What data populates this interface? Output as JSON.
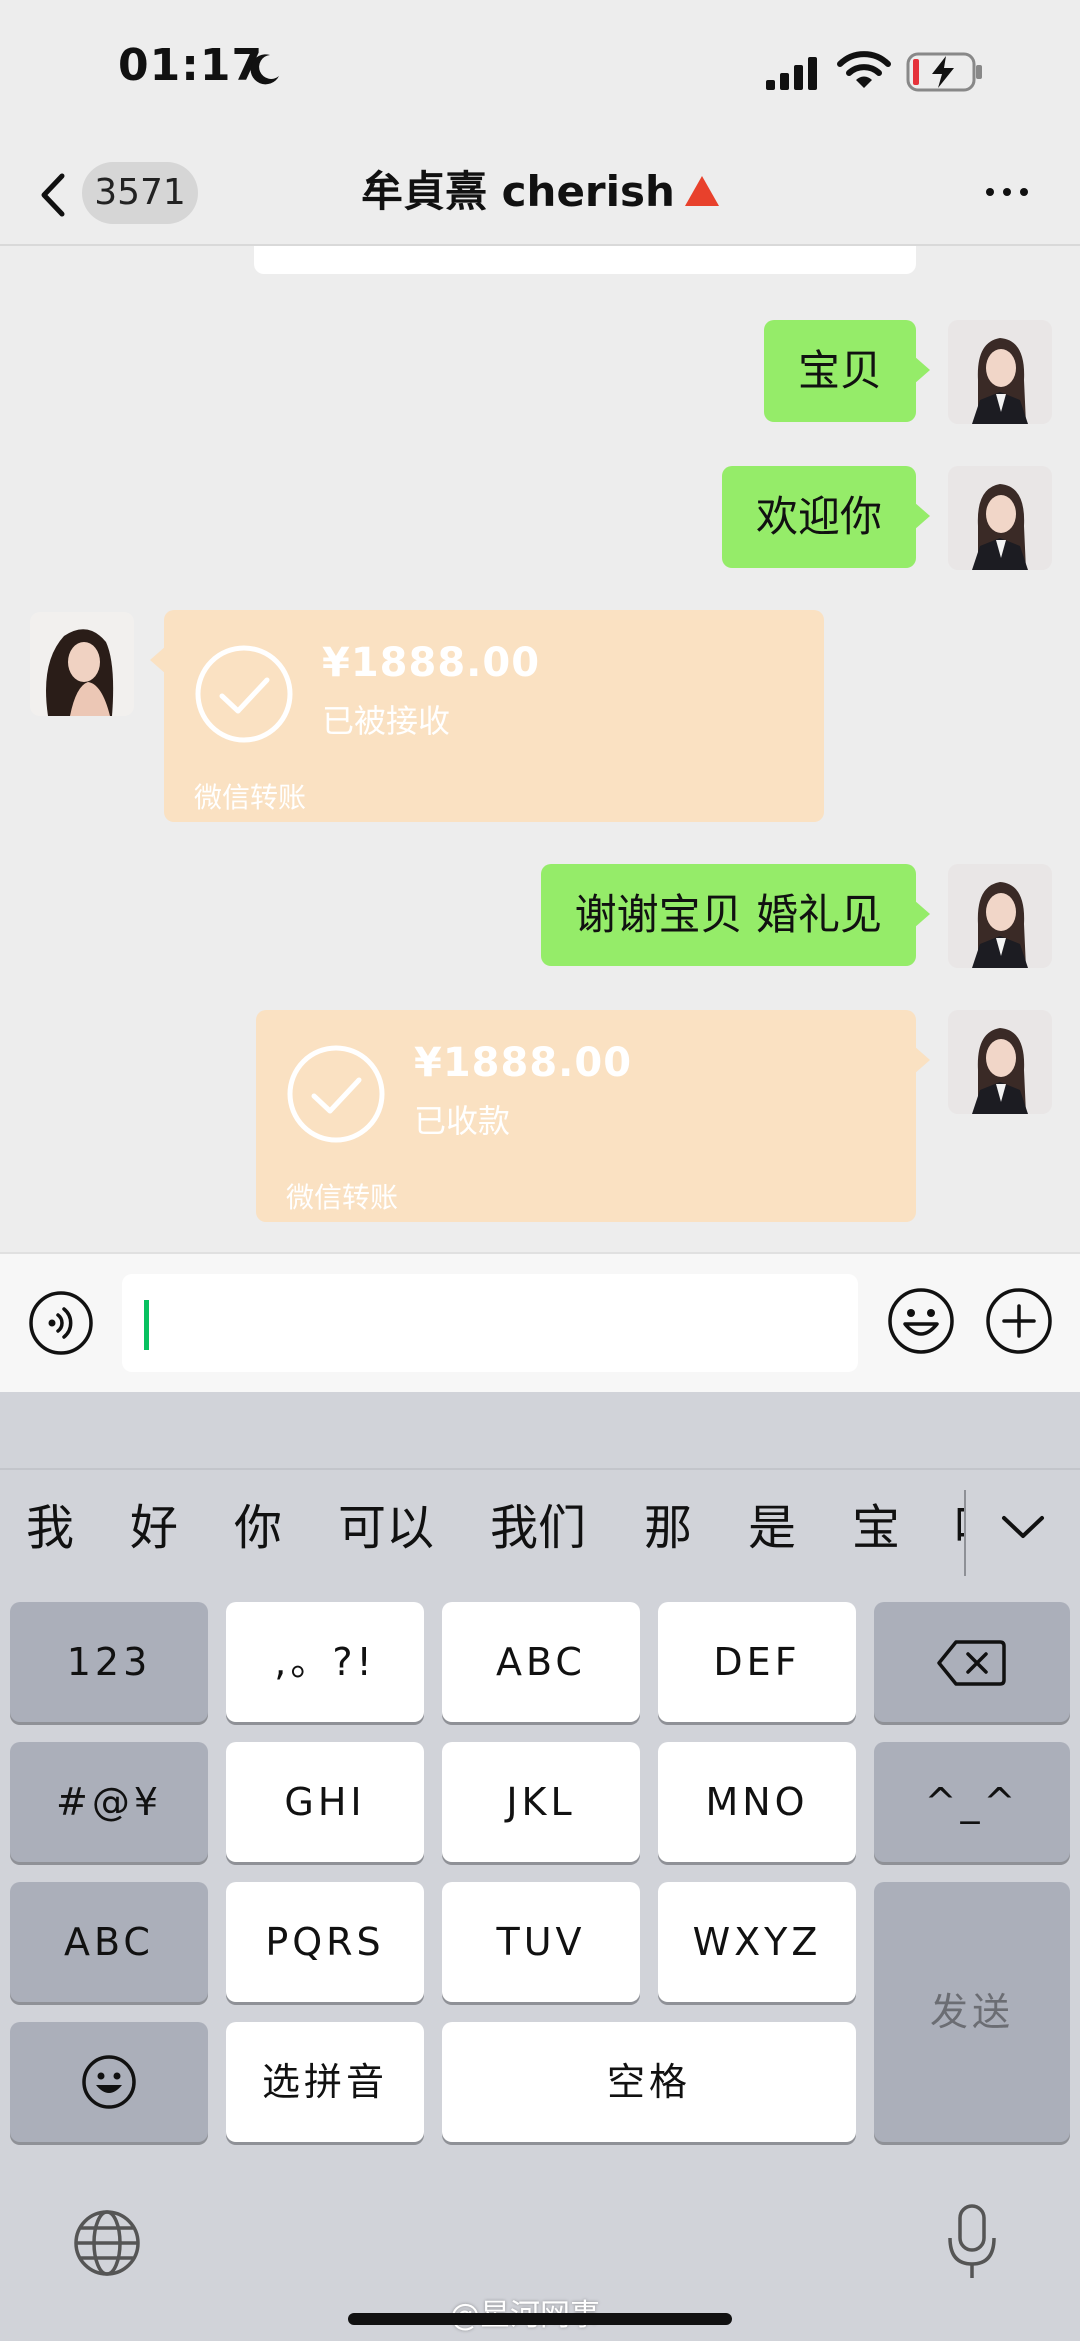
{
  "status_bar": {
    "time": "01:17"
  },
  "nav": {
    "unread_count": "3571",
    "title": "牟貞熹 cherish"
  },
  "messages": [
    {
      "side": "right",
      "type": "text",
      "text": "宝贝"
    },
    {
      "side": "right",
      "type": "text",
      "text": "欢迎你"
    },
    {
      "side": "left",
      "type": "transfer",
      "amount": "¥1888.00",
      "status": "已被接收",
      "label": "微信转账"
    },
    {
      "side": "right",
      "type": "text",
      "text": "谢谢宝贝 婚礼见"
    },
    {
      "side": "right",
      "type": "transfer",
      "amount": "¥1888.00",
      "status": "已收款",
      "label": "微信转账"
    }
  ],
  "keyboard": {
    "candidates": [
      "我",
      "好",
      "你",
      "可以",
      "我们",
      "那",
      "是",
      "宝",
      "吖"
    ],
    "keys": {
      "num": "123",
      "punct": ",。?!",
      "abc2": "ABC",
      "def3": "DEF",
      "symbols": "#@¥",
      "ghi": "GHI",
      "jkl": "JKL",
      "mno": "MNO",
      "kaomoji": "^_^",
      "abc_switch": "ABC",
      "pqrs": "PQRS",
      "tuv": "TUV",
      "wxyz": "WXYZ",
      "send": "发送",
      "pinyin": "选拼音",
      "space": "空格"
    }
  },
  "watermark": "@星河网事",
  "colors": {
    "outgoing_bubble": "#95ec69",
    "transfer_card": "#fae1c2",
    "cursor": "#07c160",
    "title_triangle": "#e8412c"
  }
}
